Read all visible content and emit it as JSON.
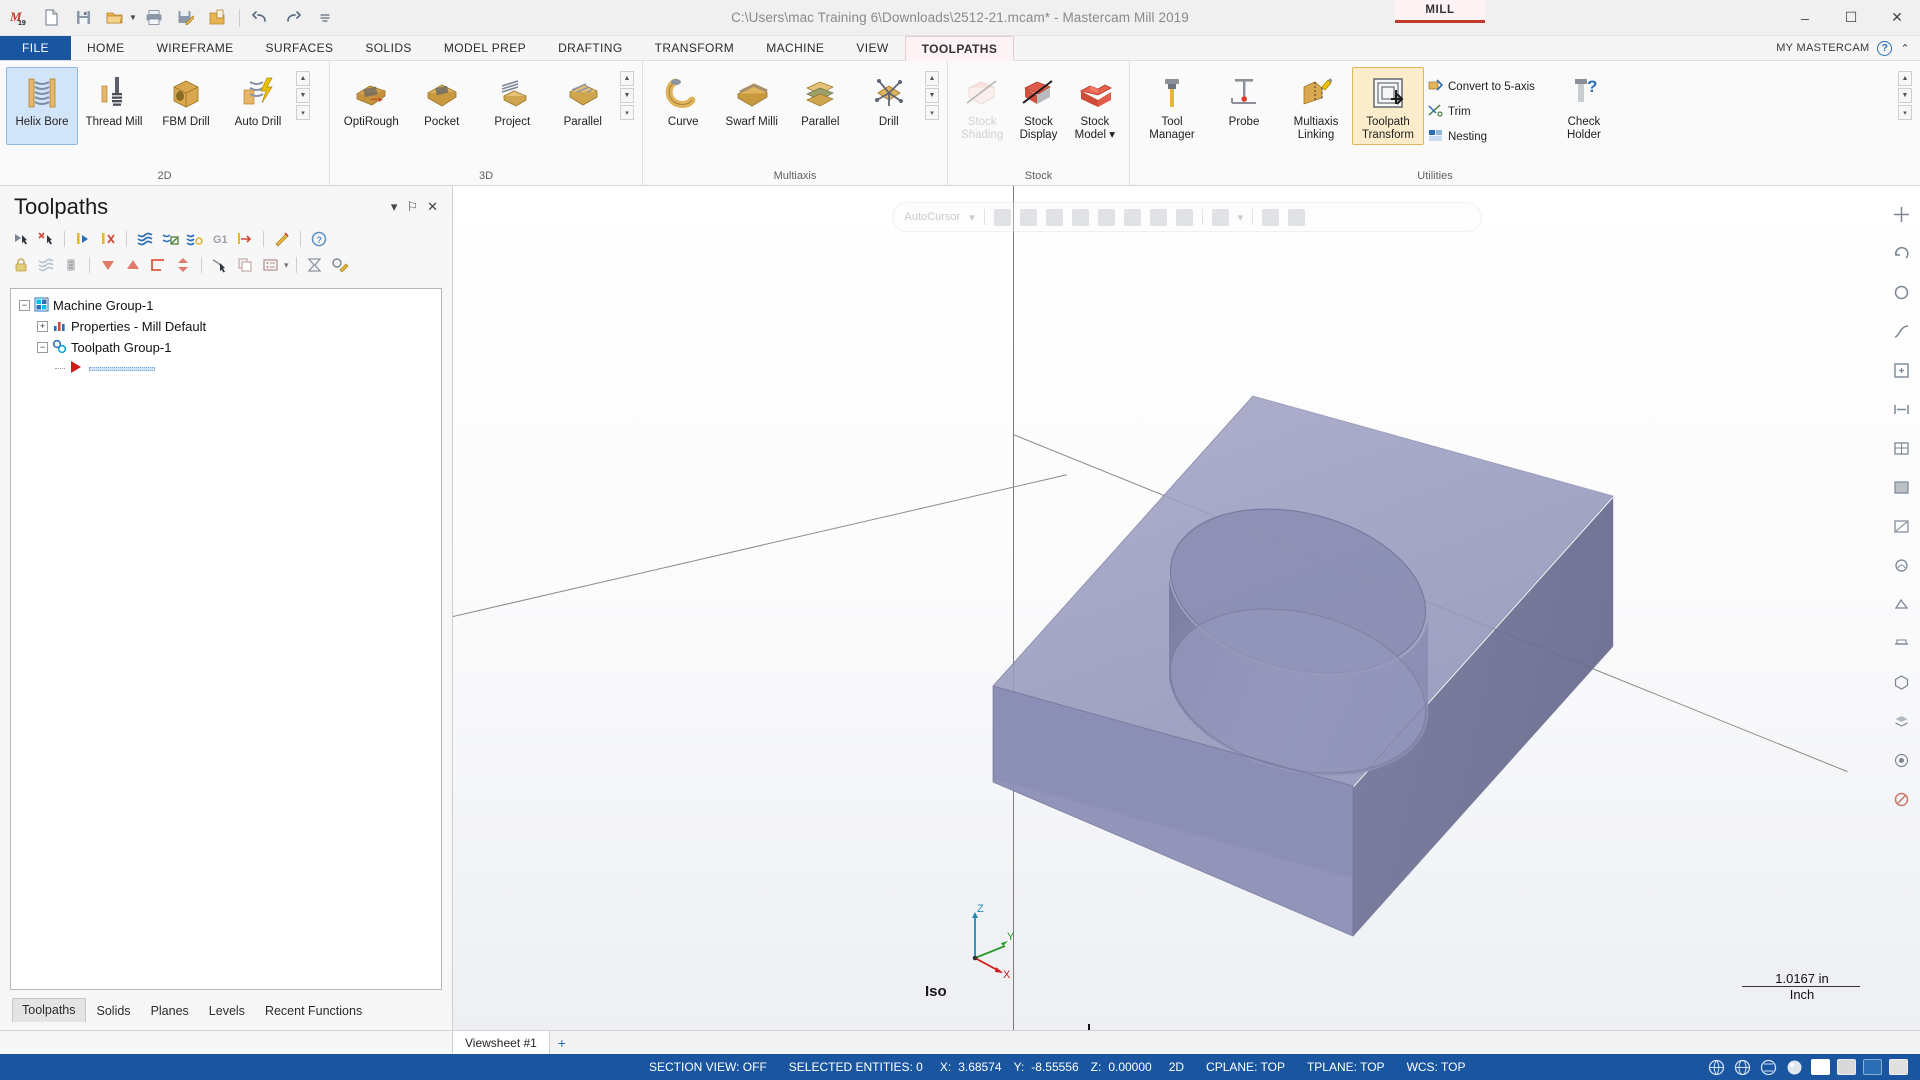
{
  "window": {
    "title": "C:\\Users\\mac Training 6\\Downloads\\2512-21.mcam* - Mastercam Mill 2019",
    "mill_tab": "MILL",
    "minimize": "–",
    "maximize": "☐",
    "close": "✕"
  },
  "quick_access": [
    {
      "name": "mastercam-logo-icon",
      "glyph": "M"
    },
    {
      "name": "new-file-icon",
      "glyph": "὜B"
    },
    {
      "name": "save-icon",
      "glyph": "ὋE"
    },
    {
      "name": "open-folder-icon",
      "glyph": "Ὄ2"
    },
    {
      "name": "print-icon",
      "glyph": "὚8"
    },
    {
      "name": "save-as-icon",
      "glyph": "ὍD"
    },
    {
      "name": "open-in-editor-icon",
      "glyph": "὜2"
    },
    {
      "name": "undo-icon",
      "glyph": "↶"
    },
    {
      "name": "redo-icon",
      "glyph": "↷"
    },
    {
      "name": "customize-qat-icon",
      "glyph": "≡"
    }
  ],
  "tabs": [
    {
      "label": "FILE",
      "kind": "file"
    },
    {
      "label": "HOME",
      "kind": "normal"
    },
    {
      "label": "WIREFRAME",
      "kind": "normal"
    },
    {
      "label": "SURFACES",
      "kind": "normal"
    },
    {
      "label": "SOLIDS",
      "kind": "normal"
    },
    {
      "label": "MODEL PREP",
      "kind": "normal"
    },
    {
      "label": "DRAFTING",
      "kind": "normal"
    },
    {
      "label": "TRANSFORM",
      "kind": "normal"
    },
    {
      "label": "MACHINE",
      "kind": "normal"
    },
    {
      "label": "VIEW",
      "kind": "normal"
    },
    {
      "label": "TOOLPATHS",
      "kind": "active"
    }
  ],
  "account": {
    "label": "MY MASTERCAM",
    "help": "?",
    "collapse": "⌃"
  },
  "ribbon": {
    "groups": [
      {
        "title": "2D",
        "buttons": [
          {
            "label": "Helix Bore",
            "icon": "helix-bore-icon",
            "state": "selected"
          },
          {
            "label": "Thread Mill",
            "icon": "thread-mill-icon",
            "state": "normal"
          },
          {
            "label": "FBM Drill",
            "icon": "fbm-drill-icon",
            "state": "normal"
          },
          {
            "label": "Auto Drill",
            "icon": "auto-drill-icon",
            "state": "normal"
          }
        ],
        "has_spinner": true
      },
      {
        "title": "3D",
        "buttons": [
          {
            "label": "OptiRough",
            "icon": "optirough-icon",
            "state": "normal"
          },
          {
            "label": "Pocket",
            "icon": "pocket-icon",
            "state": "normal"
          },
          {
            "label": "Project",
            "icon": "project-icon",
            "state": "normal"
          },
          {
            "label": "Parallel",
            "icon": "parallel-3d-icon",
            "state": "normal"
          }
        ],
        "has_spinner": true
      },
      {
        "title": "Multiaxis",
        "buttons": [
          {
            "label": "Curve",
            "icon": "curve-icon",
            "state": "normal"
          },
          {
            "label": "Swarf Milli",
            "icon": "swarf-milling-icon",
            "state": "normal"
          },
          {
            "label": "Parallel",
            "icon": "parallel-multiaxis-icon",
            "state": "normal"
          },
          {
            "label": "Drill",
            "icon": "drill-multiaxis-icon",
            "state": "normal"
          }
        ],
        "has_spinner": true
      },
      {
        "title": "Stock",
        "buttons": [
          {
            "label": "Stock Shading",
            "icon": "stock-shading-icon",
            "state": "disabled"
          },
          {
            "label": "Stock Display",
            "icon": "stock-display-icon",
            "state": "normal"
          },
          {
            "label": "Stock Model ▾",
            "icon": "stock-model-icon",
            "state": "normal"
          }
        ],
        "has_spinner": false
      },
      {
        "title": "Utilities",
        "buttons": [
          {
            "label": "Tool Manager",
            "icon": "tool-manager-icon",
            "state": "normal"
          },
          {
            "label": "Probe",
            "icon": "probe-icon",
            "state": "normal"
          },
          {
            "label": "Multiaxis Linking",
            "icon": "multiaxis-linking-icon",
            "state": "normal"
          },
          {
            "label": "Toolpath Transform",
            "icon": "toolpath-transform-icon",
            "state": "highlight"
          }
        ],
        "small_buttons": [
          {
            "label": "Convert to 5-axis",
            "icon": "convert-5axis-icon"
          },
          {
            "label": "Trim",
            "icon": "trim-icon"
          },
          {
            "label": "Nesting",
            "icon": "nesting-icon"
          }
        ],
        "tail_button": {
          "label": "Check Holder",
          "icon": "check-holder-icon"
        },
        "has_spinner": false
      }
    ]
  },
  "toolpaths_panel": {
    "title": "Toolpaths",
    "header_buttons": [
      {
        "name": "minimize-panel-button",
        "glyph": "▾"
      },
      {
        "name": "pin-panel-button",
        "glyph": "⚐"
      },
      {
        "name": "close-panel-button",
        "glyph": "✕"
      }
    ],
    "toolbar_row1": [
      {
        "name": "select-all-toolpaths-icon",
        "glyph": "▶"
      },
      {
        "name": "deselect-all-toolpaths-icon",
        "glyph": "✕"
      },
      {
        "name": "regenerate-selected-icon",
        "glyph": "↻"
      },
      {
        "name": "regenerate-invalid-icon",
        "glyph": "✗"
      },
      {
        "name": "verify-toolpaths-icon",
        "glyph": "≈"
      },
      {
        "name": "backplot-toolpaths-icon",
        "glyph": "◱"
      },
      {
        "name": "simulate-toolpaths-icon",
        "glyph": "≈"
      },
      {
        "name": "post-selected-operations-icon",
        "glyph": "G1"
      },
      {
        "name": "high-speed-toolpath-icon",
        "glyph": "↦"
      },
      {
        "name": "toolpath-tools-icon",
        "glyph": "✎"
      },
      {
        "name": "help-toolpaths-icon",
        "glyph": "?"
      }
    ],
    "toolbar_row2": [
      {
        "name": "lock-selected-operations-icon",
        "glyph": "ὑ2"
      },
      {
        "name": "toggle-toolpath-display-icon",
        "glyph": "≈"
      },
      {
        "name": "toggle-posting-icon",
        "glyph": "☷"
      },
      {
        "name": "move-down-icon",
        "glyph": "▼"
      },
      {
        "name": "move-up-icon",
        "glyph": "▲"
      },
      {
        "name": "toggle-insert-arrow-icon",
        "glyph": "⌐"
      },
      {
        "name": "move-insert-arrow-icon",
        "glyph": "⇅"
      },
      {
        "name": "only-display-selected-icon",
        "glyph": "✂"
      },
      {
        "name": "copy-operations-icon",
        "glyph": "⧉"
      },
      {
        "name": "operation-details-icon",
        "glyph": "☷"
      },
      {
        "name": "expand-collapse-icon",
        "glyph": "∑"
      },
      {
        "name": "toolpath-group-options-icon",
        "glyph": "⚙"
      }
    ],
    "tree": [
      {
        "label": "Machine Group-1",
        "indent": 0,
        "expander": "−",
        "icon": "machine-group-icon",
        "selected": false
      },
      {
        "label": "Properties - Mill Default",
        "indent": 1,
        "expander": "+",
        "icon": "properties-icon",
        "selected": false
      },
      {
        "label": "Toolpath Group-1",
        "indent": 1,
        "expander": "−",
        "icon": "toolpath-group-icon",
        "selected": false
      },
      {
        "label": "",
        "indent": 2,
        "expander": "",
        "icon": "insert-arrow-icon",
        "selected": true
      }
    ],
    "bottom_tabs": [
      {
        "label": "Toolpaths",
        "active": true
      },
      {
        "label": "Solids",
        "active": false
      },
      {
        "label": "Planes",
        "active": false
      },
      {
        "label": "Levels",
        "active": false
      },
      {
        "label": "Recent Functions",
        "active": false
      }
    ]
  },
  "viewport": {
    "gnomon": {
      "x": "X",
      "y": "Y",
      "z": "Z"
    },
    "view_label": "Iso",
    "scale": {
      "value": "1.0167 in",
      "unit": "Inch"
    },
    "floating_toolbar_text": "AutoCursor",
    "right_tools": [
      {
        "name": "fit-view-icon",
        "glyph": "✥"
      },
      {
        "name": "dynamic-rotate-icon",
        "glyph": "↻"
      },
      {
        "name": "orbit-view-icon",
        "glyph": "○"
      },
      {
        "name": "pan-view-icon",
        "glyph": "⤡"
      },
      {
        "name": "zoom-window-icon",
        "glyph": "⊞"
      },
      {
        "name": "zoom-fit-icon",
        "glyph": "↔"
      },
      {
        "name": "wireframe-shading-icon",
        "glyph": "▧"
      },
      {
        "name": "shaded-display-icon",
        "glyph": "▣"
      },
      {
        "name": "translucent-display-icon",
        "glyph": "▤"
      },
      {
        "name": "material-display-icon",
        "glyph": "▥"
      },
      {
        "name": "edge-display-icon",
        "glyph": "▦"
      },
      {
        "name": "section-view-icon",
        "glyph": "⯀"
      },
      {
        "name": "isometric-view-icon",
        "glyph": "◈"
      },
      {
        "name": "layers-icon",
        "glyph": "☰"
      },
      {
        "name": "highlight-icon",
        "glyph": "◎"
      },
      {
        "name": "blank-entities-icon",
        "glyph": "⊘"
      }
    ]
  },
  "viewsheet": {
    "tabs": [
      {
        "label": "Viewsheet #1"
      }
    ],
    "add": "+"
  },
  "statusbar": {
    "section_view": "SECTION VIEW: OFF",
    "selected_entities": "SELECTED ENTITIES: 0",
    "x_label": "X:",
    "x_value": "3.68574",
    "y_label": "Y:",
    "y_value": "-8.55556",
    "z_label": "Z:",
    "z_value": "0.00000",
    "mode_2d": "2D",
    "cplane": "CPLANE: TOP",
    "tplane": "TPLANE: TOP",
    "wcs": "WCS: TOP",
    "icons": [
      {
        "name": "globe-wcs-icon",
        "glyph": "●"
      },
      {
        "name": "globe-cplane-icon",
        "glyph": "●"
      },
      {
        "name": "globe-tplane-icon",
        "glyph": "●"
      }
    ],
    "swatches": [
      "#ffffff",
      "#d9d9d9",
      "#2a6fb5",
      "#e0e0e0"
    ]
  },
  "colors": {
    "accent": "#1a56a0",
    "file_tab": "#1a56a0",
    "mill_accent": "#c0392b",
    "selection": "#cfe3f5",
    "model_top": "#9a9cc0",
    "model_left": "#8b8eb4",
    "model_right": "#6e7192"
  }
}
